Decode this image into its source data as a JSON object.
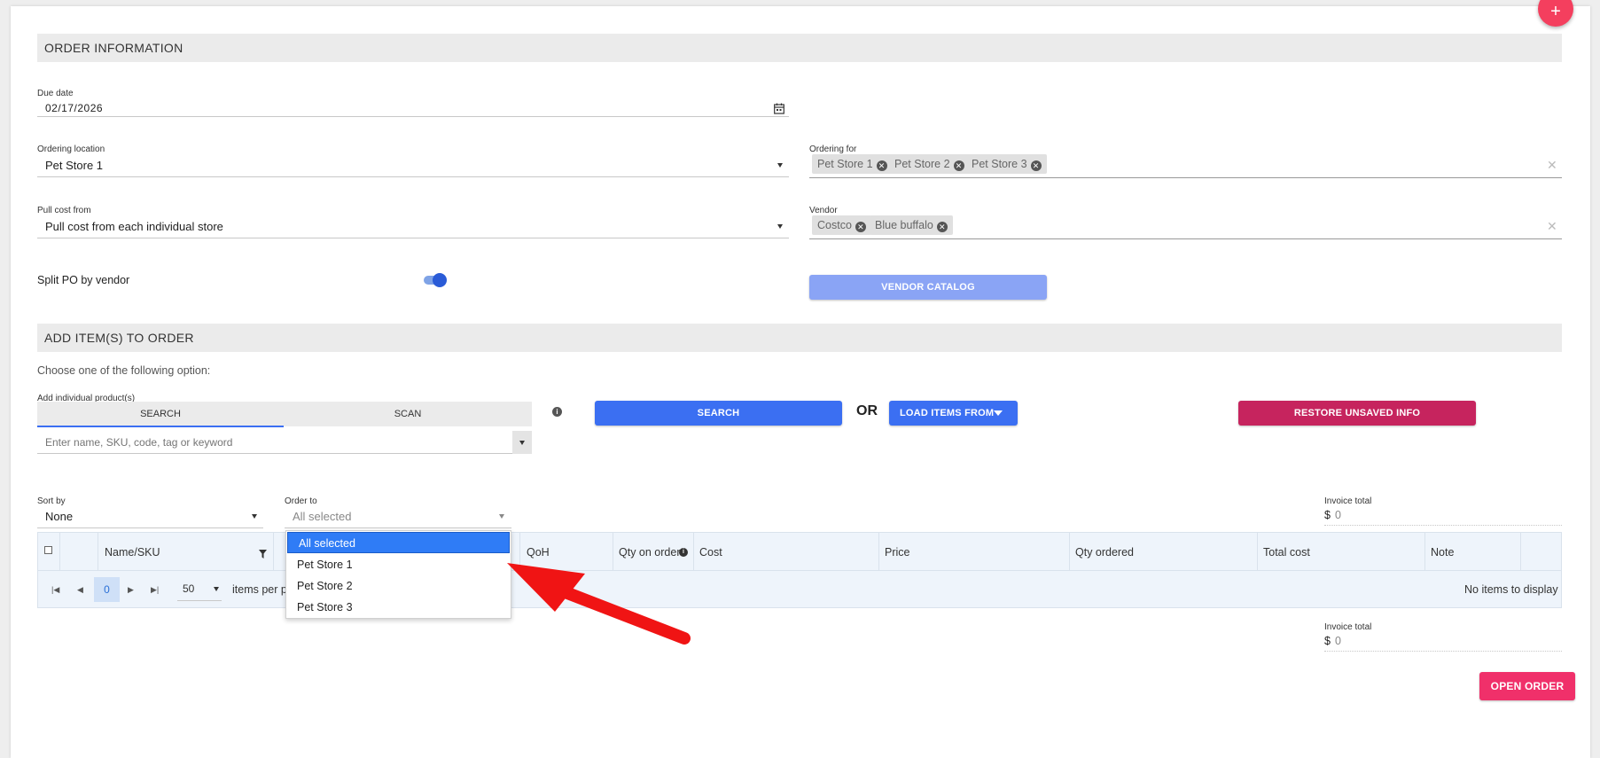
{
  "order_info": {
    "title": "ORDER INFORMATION",
    "due_date": {
      "label": "Due date",
      "value": "02/17/2026"
    },
    "ordering_location": {
      "label": "Ordering location",
      "value": "Pet Store 1"
    },
    "ordering_for": {
      "label": "Ordering for",
      "chips": [
        "Pet Store 1",
        "Pet Store 2",
        "Pet Store 3"
      ]
    },
    "pull_cost_from": {
      "label": "Pull cost from",
      "value": "Pull cost from each individual store"
    },
    "vendor": {
      "label": "Vendor",
      "chips": [
        "Costco",
        "Blue buffalo"
      ]
    },
    "split_po": {
      "label": "Split PO by vendor",
      "on": true
    },
    "vendor_catalog_label": "VENDOR CATALOG"
  },
  "add_items": {
    "title": "ADD ITEM(S) TO ORDER",
    "choose_text": "Choose one of the following option:",
    "individual_label": "Add individual product(s)",
    "tabs": [
      "SEARCH",
      "SCAN"
    ],
    "search_placeholder": "Enter name, SKU, code, tag or keyword",
    "search_button": "SEARCH",
    "or_text": "OR",
    "load_items_button": "LOAD ITEMS FROM",
    "restore_button": "RESTORE UNSAVED INFO"
  },
  "filters": {
    "sort_by": {
      "label": "Sort by",
      "value": "None"
    },
    "order_to": {
      "label": "Order to",
      "value": "All selected"
    },
    "invoice_total": {
      "label": "Invoice total",
      "currency": "$",
      "value": "0"
    }
  },
  "order_to_dropdown": {
    "options": [
      "All selected",
      "Pet Store 1",
      "Pet Store 2",
      "Pet Store 3"
    ],
    "selected": "All selected"
  },
  "grid": {
    "columns": [
      "Name/SKU",
      "QoH",
      "Qty on order",
      "Cost",
      "Price",
      "Qty ordered",
      "Total cost",
      "Note"
    ],
    "pager": {
      "page": "0",
      "page_size": "50",
      "items_per_page_text": "items per p"
    },
    "empty_text": "No items to display"
  },
  "footer": {
    "invoice_total": {
      "label": "Invoice total",
      "currency": "$",
      "value": "0"
    },
    "open_order_button": "OPEN ORDER"
  },
  "colors": {
    "primary": "#3b6ff2",
    "vendor_catalog": "#8aa4f5",
    "restore": "#c6245e",
    "open_order": "#f0306a",
    "fab": "#f43f5e",
    "annotation_arrow": "#f01414"
  },
  "icons": [
    "plus-icon",
    "calendar-icon",
    "info-icon",
    "filter-icon",
    "remove-chip-icon",
    "close-icon",
    "chevron-down-icon"
  ]
}
